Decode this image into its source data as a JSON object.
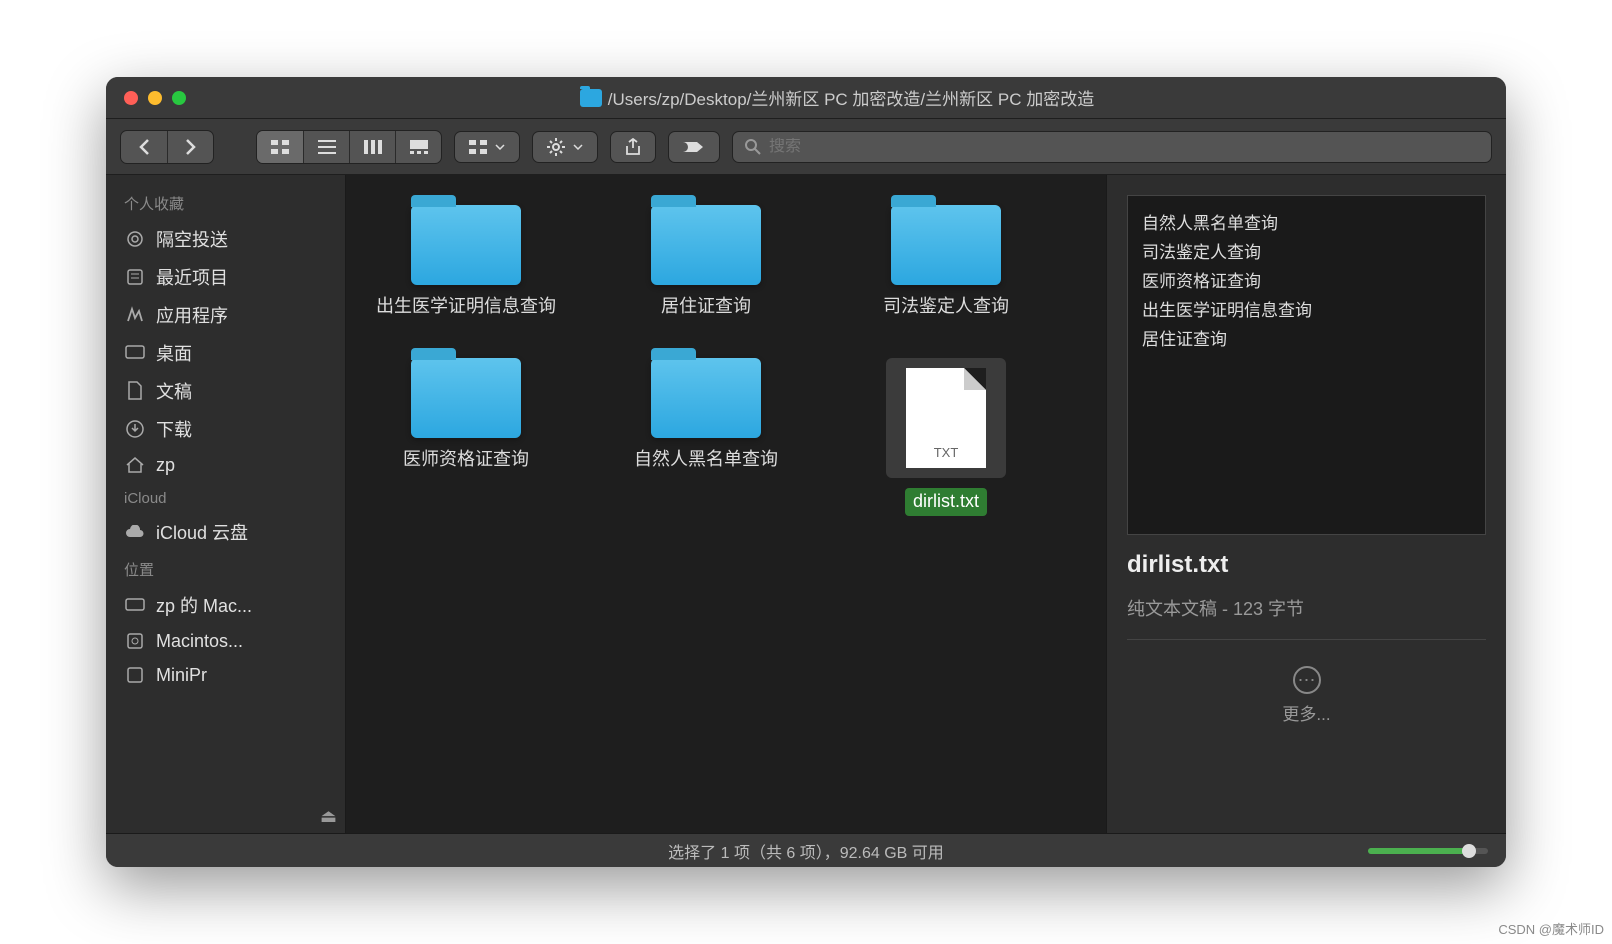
{
  "window": {
    "path": "/Users/zp/Desktop/兰州新区 PC 加密改造/兰州新区 PC 加密改造"
  },
  "search": {
    "placeholder": "搜索"
  },
  "sidebar": {
    "sections": {
      "favorites": "个人收藏",
      "icloud": "iCloud",
      "locations": "位置"
    },
    "items": [
      {
        "label": "隔空投送"
      },
      {
        "label": "最近项目"
      },
      {
        "label": "应用程序"
      },
      {
        "label": "桌面"
      },
      {
        "label": "文稿"
      },
      {
        "label": "下载"
      },
      {
        "label": "zp"
      },
      {
        "label": "iCloud 云盘"
      },
      {
        "label": "zp 的 Mac..."
      },
      {
        "label": "Macintos..."
      },
      {
        "label": "MiniPr"
      }
    ]
  },
  "files": [
    {
      "name": "出生医学证明信息查询",
      "type": "folder"
    },
    {
      "name": "居住证查询",
      "type": "folder"
    },
    {
      "name": "司法鉴定人查询",
      "type": "folder"
    },
    {
      "name": "医师资格证查询",
      "type": "folder"
    },
    {
      "name": "自然人黑名单查询",
      "type": "folder"
    },
    {
      "name": "dirlist.txt",
      "type": "txt",
      "ext": "TXT",
      "selected": true
    }
  ],
  "preview": {
    "lines": [
      "自然人黑名单查询",
      "司法鉴定人查询",
      "医师资格证查询",
      "出生医学证明信息查询",
      "居住证查询"
    ],
    "title": "dirlist.txt",
    "subtitle": "纯文本文稿 - 123 字节",
    "more": "更多..."
  },
  "status": {
    "text": "选择了 1 项（共 6 项），92.64 GB 可用"
  },
  "watermark": "CSDN @魔术师ID"
}
